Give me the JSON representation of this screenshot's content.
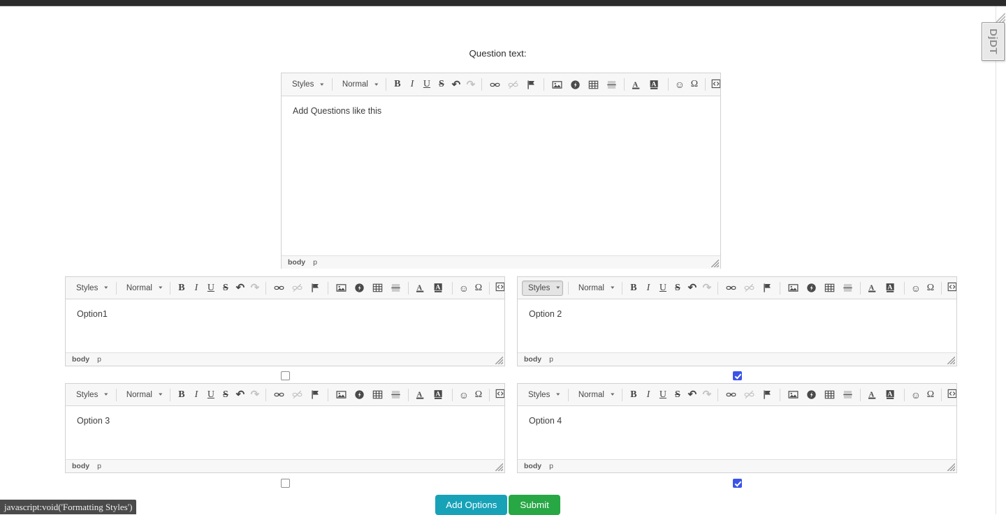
{
  "status_bar": {
    "text": "javascript:void('Formatting Styles')"
  },
  "debug_toolbar": {
    "label": "DjDT"
  },
  "question": {
    "label": "Question text:",
    "editor": {
      "styles_label": "Styles",
      "format_label": "Normal",
      "source_label": "Source",
      "content": "Add Questions like this",
      "elements_path": [
        "body",
        "p"
      ]
    }
  },
  "toolbar_buttons": [
    {
      "name": "bold-icon",
      "glyph": "B",
      "style": "bold",
      "disabled": false
    },
    {
      "name": "italic-icon",
      "glyph": "I",
      "style": "italic",
      "disabled": false
    },
    {
      "name": "underline-icon",
      "glyph": "U",
      "style": "underline",
      "disabled": false
    },
    {
      "name": "strikethrough-icon",
      "glyph": "S",
      "style": "strike",
      "disabled": false
    },
    {
      "name": "undo-icon",
      "glyph": "↶",
      "style": "plain",
      "disabled": false
    },
    {
      "name": "redo-icon",
      "glyph": "↷",
      "style": "plain",
      "disabled": true
    },
    {
      "name": "link-icon",
      "glyph": "link",
      "style": "svg",
      "disabled": false
    },
    {
      "name": "unlink-icon",
      "glyph": "unlink",
      "style": "svg",
      "disabled": true
    },
    {
      "name": "anchor-flag-icon",
      "glyph": "flag",
      "style": "svg",
      "disabled": false
    },
    {
      "name": "image-icon",
      "glyph": "image",
      "style": "svg",
      "disabled": false
    },
    {
      "name": "flash-media-icon",
      "glyph": "flash",
      "style": "svg",
      "disabled": false
    },
    {
      "name": "table-icon",
      "glyph": "table",
      "style": "svg",
      "disabled": false
    },
    {
      "name": "horizontal-rule-icon",
      "glyph": "hrule",
      "style": "svg",
      "disabled": false
    },
    {
      "name": "text-color-icon",
      "glyph": "textcolor",
      "style": "svg",
      "disabled": false
    },
    {
      "name": "background-color-icon",
      "glyph": "bgcolor",
      "style": "svg",
      "disabled": false
    },
    {
      "name": "smiley-icon",
      "glyph": "☺",
      "style": "plain",
      "disabled": false
    },
    {
      "name": "special-character-icon",
      "glyph": "Ω",
      "style": "plain",
      "disabled": false
    }
  ],
  "options": [
    {
      "id": "option-1",
      "content": "Option1",
      "styles_label": "Styles",
      "format_label": "Normal",
      "source_label": "Source",
      "styles_active": false,
      "elements_path": [
        "body",
        "p"
      ],
      "correct": false
    },
    {
      "id": "option-2",
      "content": "Option 2",
      "styles_label": "Styles",
      "format_label": "Normal",
      "source_label": "Source",
      "styles_active": true,
      "elements_path": [
        "body",
        "p"
      ],
      "correct": true
    },
    {
      "id": "option-3",
      "content": "Option 3",
      "styles_label": "Styles",
      "format_label": "Normal",
      "source_label": "Source",
      "styles_active": false,
      "elements_path": [
        "body",
        "p"
      ],
      "correct": false
    },
    {
      "id": "option-4",
      "content": "Option 4",
      "styles_label": "Styles",
      "format_label": "Normal",
      "source_label": "Source",
      "styles_active": false,
      "elements_path": [
        "body",
        "p"
      ],
      "correct": true
    }
  ],
  "actions": {
    "add_options_label": "Add Options",
    "submit_label": "Submit",
    "add_options_color": "#17a2b8",
    "submit_color": "#28a745"
  }
}
